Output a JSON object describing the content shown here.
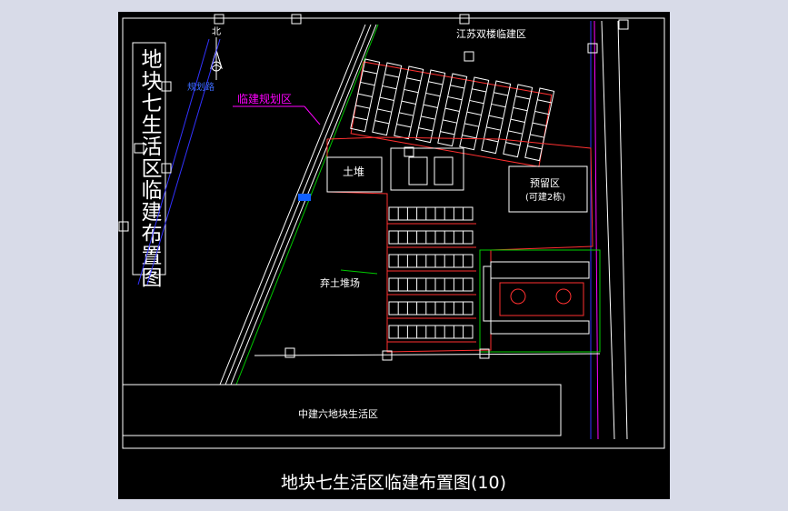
{
  "drawing": {
    "title": "地块七生活区临建布置图(10)",
    "side_title": "地块七生活区临建布置图",
    "north_label": "北",
    "labels": {
      "top_zone": "江苏双楼临建区",
      "planning_zone": "临建规划区",
      "planning_road": "规划路",
      "soil_pile": "土堆",
      "spoil_yard": "弃土堆场",
      "reserved_zone": "预留区",
      "reserved_note": "(可建2栋)",
      "bottom_zone": "中建六地块生活区"
    },
    "colors": {
      "background": "#000000",
      "frame": "#ffffff",
      "road_line": "#3232ff",
      "fence": "#ff3030",
      "building": "#ffffff",
      "annotation": "#ff00ff",
      "green": "#00d000",
      "cyan": "#00c8c8"
    }
  }
}
